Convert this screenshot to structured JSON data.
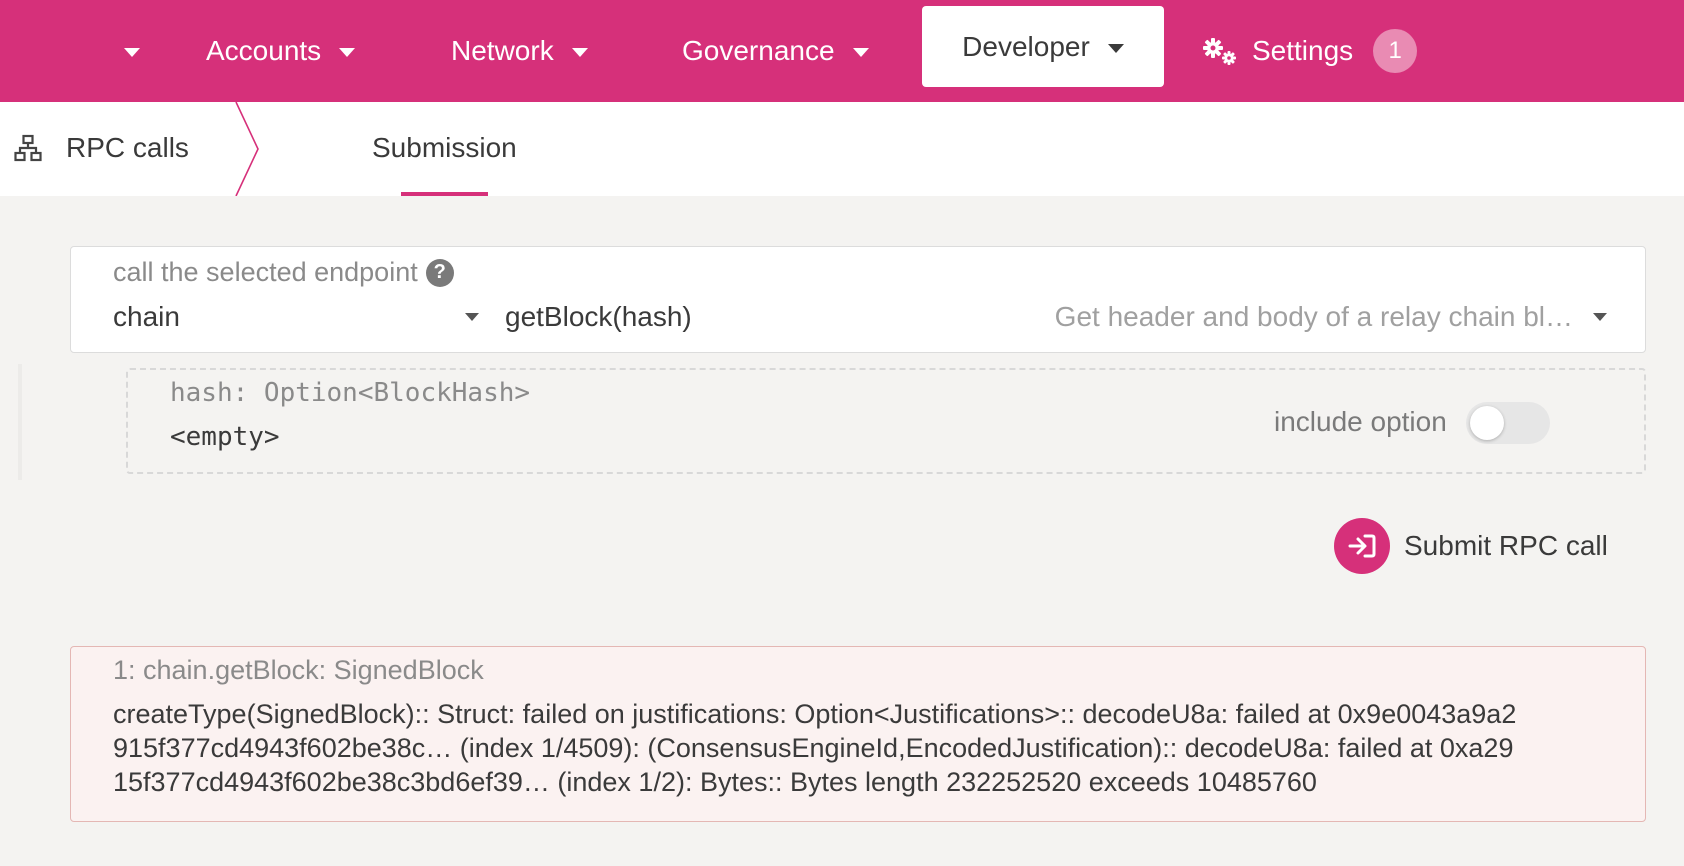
{
  "nav": {
    "accounts": "Accounts",
    "network": "Network",
    "governance": "Governance",
    "developer": "Developer",
    "settings": "Settings",
    "settings_badge": "1"
  },
  "subnav": {
    "title": "RPC calls",
    "tab_submission": "Submission"
  },
  "endpoint": {
    "label": "call the selected endpoint",
    "help": "?",
    "section_value": "chain",
    "method_value": "getBlock(hash)",
    "method_description": "Get header and body of a relay chain bl…"
  },
  "param": {
    "label": "hash: Option<BlockHash>",
    "value": "<empty>",
    "include_label": "include option",
    "include_enabled": false
  },
  "submit": {
    "label": "Submit RPC call"
  },
  "result": {
    "title": "1: chain.getBlock: SignedBlock",
    "lines": [
      "createType(SignedBlock):: Struct: failed on justifications: Option<Justifications>:: decodeU8a: failed at 0x9e0043a9a2",
      "915f377cd4943f602be38c… (index 1/4509): (ConsensusEngineId,EncodedJustification):: decodeU8a: failed at 0xa29",
      "15f377cd4943f602be38c3bd6ef39… (index 1/2): Bytes:: Bytes length 232252520 exceeds 10485760"
    ]
  },
  "colors": {
    "brand": "#d6307a",
    "badge": "#e98bb3",
    "error_bg": "#fbf2f1",
    "error_border": "#e4b7b4"
  },
  "icons": [
    "chevron-down-icon",
    "gear-icon",
    "network-icon",
    "help-icon",
    "submit-arrow-icon"
  ]
}
